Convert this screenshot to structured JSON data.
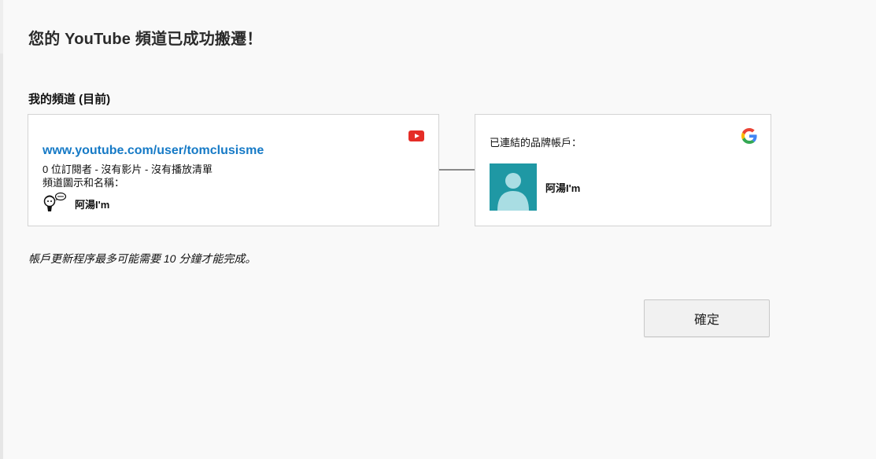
{
  "dialog": {
    "title": "您的 YouTube 頻道已成功搬遷！",
    "section_label": "我的頻道 (目前)",
    "note": "帳戶更新程序最多可能需要 10 分鐘才能完成。",
    "ok_label": "確定"
  },
  "channel_card": {
    "url": "www.youtube.com/user/tomclusisme",
    "stats": "0 位訂閱者 - 沒有影片 - 沒有播放清單",
    "icon_and_name_label": "頻道圖示和名稱：",
    "channel_name": "阿湯I'm",
    "icon": "youtube-icon"
  },
  "brand_card": {
    "label": "已連結的品牌帳戶：",
    "account_name": "阿湯I'm",
    "icon": "google-icon"
  },
  "colors": {
    "background": "#f9f9f9",
    "link": "#167ac6",
    "youtube_red": "#e52d27",
    "avatar_teal": "#1f98a4"
  }
}
